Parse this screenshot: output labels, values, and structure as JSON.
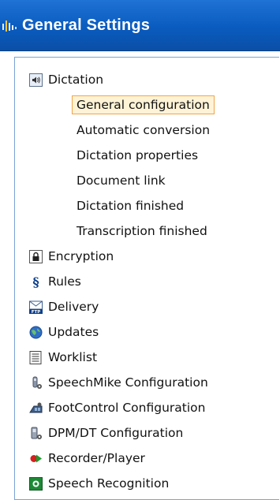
{
  "header": {
    "title": "General Settings"
  },
  "tree": {
    "dictation": {
      "label": "Dictation",
      "icon": "speaker-icon",
      "children": [
        {
          "label": "General configuration",
          "selected": true
        },
        {
          "label": "Automatic conversion"
        },
        {
          "label": "Dictation properties"
        },
        {
          "label": "Document link"
        },
        {
          "label": "Dictation finished"
        },
        {
          "label": "Transcription finished"
        }
      ]
    },
    "items": [
      {
        "label": "Encryption",
        "icon": "lock-icon"
      },
      {
        "label": "Rules",
        "icon": "section-icon"
      },
      {
        "label": "Delivery",
        "icon": "ftp-mail-icon"
      },
      {
        "label": "Updates",
        "icon": "globe-icon"
      },
      {
        "label": "Worklist",
        "icon": "list-icon"
      },
      {
        "label": "SpeechMike Configuration",
        "icon": "speechmike-icon"
      },
      {
        "label": "FootControl Configuration",
        "icon": "footcontrol-icon"
      },
      {
        "label": "DPM/DT Configuration",
        "icon": "dpm-icon"
      },
      {
        "label": "Recorder/Player",
        "icon": "recorder-icon"
      },
      {
        "label": "Speech Recognition",
        "icon": "speech-recognition-icon"
      }
    ]
  },
  "colors": {
    "header_bg": "#0a5bbf",
    "selection_border": "#f0a44a",
    "selection_bg": "#fff3d6"
  }
}
